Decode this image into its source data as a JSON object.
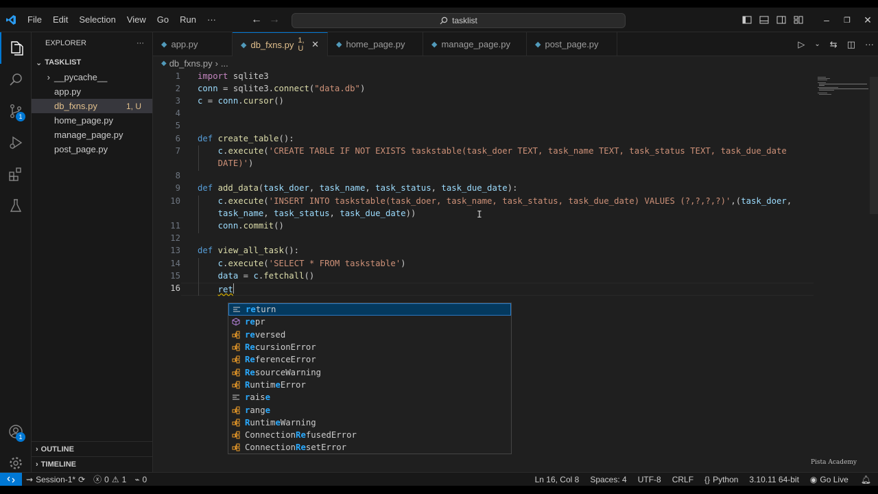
{
  "titlebar": {
    "menu": [
      "File",
      "Edit",
      "Selection",
      "View",
      "Go",
      "Run",
      "···"
    ],
    "search_text": "tasklist",
    "window_controls": [
      "minimize-icon",
      "restore-icon",
      "close-icon"
    ]
  },
  "activity_bar": {
    "items": [
      "explorer-icon",
      "search-icon",
      "source-control-icon",
      "run-debug-icon",
      "extensions-icon",
      "testing-icon"
    ],
    "source_control_badge": "1",
    "accounts_badge": "1"
  },
  "sidebar": {
    "title": "EXPLORER",
    "more": "···",
    "folder": "TASKLIST",
    "tree": [
      {
        "label": "__pycache__",
        "type": "folder"
      },
      {
        "label": "app.py",
        "type": "file"
      },
      {
        "label": "db_fxns.py",
        "type": "file",
        "status": "1, U",
        "selected": true
      },
      {
        "label": "home_page.py",
        "type": "file"
      },
      {
        "label": "manage_page.py",
        "type": "file"
      },
      {
        "label": "post_page.py",
        "type": "file"
      }
    ],
    "outline": "OUTLINE",
    "timeline": "TIMELINE"
  },
  "tabs": [
    {
      "label": "app.py",
      "active": false
    },
    {
      "label": "db_fxns.py",
      "status": "1, U",
      "active": true
    },
    {
      "label": "home_page.py",
      "active": false
    },
    {
      "label": "manage_page.py",
      "active": false
    },
    {
      "label": "post_page.py",
      "active": false
    }
  ],
  "breadcrumb": {
    "file": "db_fxns.py",
    "rest": "..."
  },
  "editor": {
    "line_numbers": [
      "1",
      "2",
      "3",
      "4",
      "5",
      "6",
      "7",
      "8",
      "9",
      "10",
      "11",
      "12",
      "13",
      "14",
      "15",
      "16"
    ],
    "current_line": "16"
  },
  "suggest": {
    "items": [
      {
        "kind": "keyword",
        "match": "re",
        "rest": "turn",
        "pre": ""
      },
      {
        "kind": "method",
        "match": "re",
        "rest": "pr",
        "pre": ""
      },
      {
        "kind": "class",
        "match": "re",
        "rest": "versed",
        "pre": ""
      },
      {
        "kind": "class",
        "match": "Re",
        "rest": "cursionError",
        "pre": ""
      },
      {
        "kind": "class",
        "match": "Re",
        "rest": "ferenceError",
        "pre": ""
      },
      {
        "kind": "class",
        "match": "Re",
        "rest": "sourceWarning",
        "pre": ""
      },
      {
        "kind": "class",
        "match": "R",
        "rest": "untim",
        "pre": "",
        "match2": "e",
        "rest2": "Error"
      },
      {
        "kind": "keyword",
        "match": "r",
        "rest": "ais",
        "pre": "",
        "match2": "e",
        "rest2": ""
      },
      {
        "kind": "class",
        "match": "r",
        "rest": "ang",
        "pre": "",
        "match2": "e",
        "rest2": ""
      },
      {
        "kind": "class",
        "match": "R",
        "rest": "untim",
        "pre": "",
        "match2": "e",
        "rest2": "Warning"
      },
      {
        "kind": "class",
        "pre": "Connection",
        "match": "Re",
        "rest": "fusedError"
      },
      {
        "kind": "class",
        "pre": "Connection",
        "match": "Re",
        "rest": "setError"
      }
    ]
  },
  "watermark": "Pista Academy",
  "statusbar": {
    "session": "Session-1*",
    "errors": "0",
    "warnings": "1",
    "ports": "0",
    "position": "Ln 16, Col 8",
    "spaces": "Spaces: 4",
    "encoding": "UTF-8",
    "eol": "CRLF",
    "language": "Python",
    "interpreter": "3.10.11 64-bit",
    "golive": "Go Live"
  },
  "colors": {
    "accent": "#0078d4",
    "modified": "#e2c08d",
    "keyword": "#c586c0",
    "string": "#ce9178",
    "function": "#dcdcaa"
  }
}
